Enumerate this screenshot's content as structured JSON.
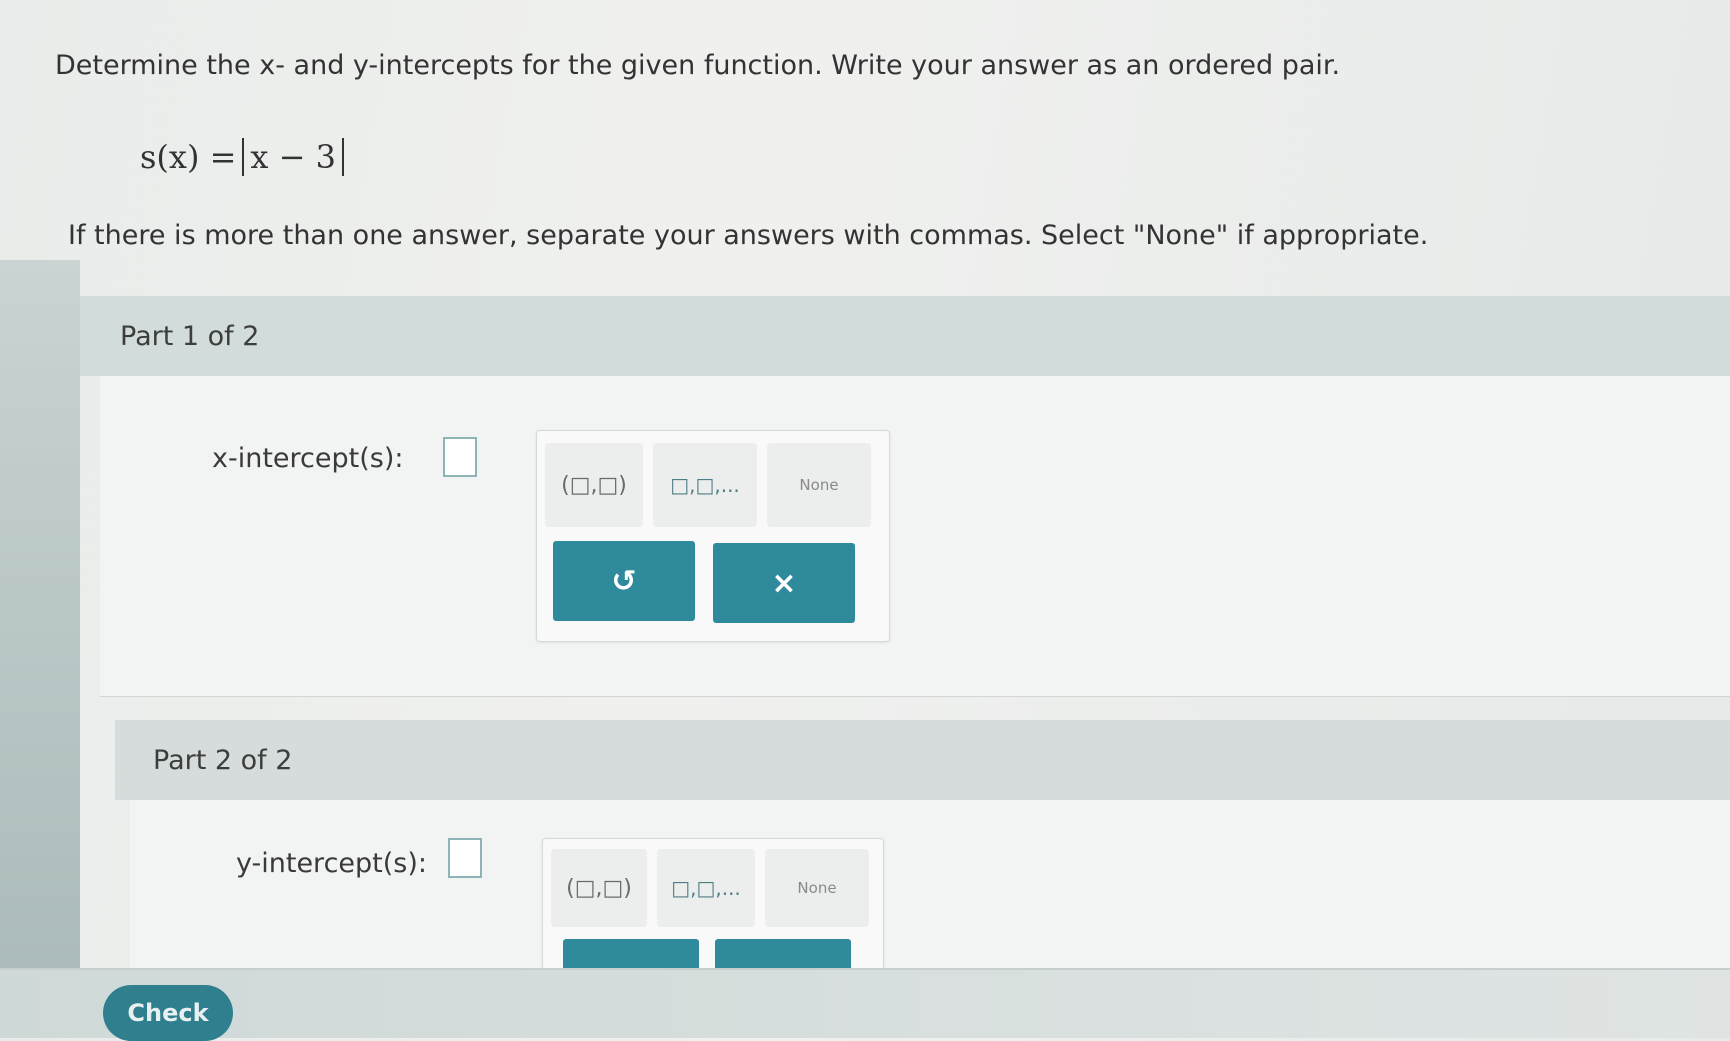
{
  "problem": {
    "prompt": "Determine the x- and y-intercepts for the given function. Write your answer as an ordered pair.",
    "function_lhs": "s(x) =",
    "function_abs": "x − 3",
    "instruction": "If there is more than one answer, separate your answers with commas. Select \"None\" if appropriate."
  },
  "part1": {
    "header": "Part 1 of 2",
    "label": "x-intercept(s):",
    "keypad": {
      "ordered_pair": "(□,□)",
      "list": "□,□,...",
      "none": "None",
      "undo": "↺",
      "clear": "×"
    }
  },
  "part2": {
    "header": "Part 2 of 2",
    "label": "y-intercept(s):",
    "keypad": {
      "ordered_pair": "(□,□)",
      "list": "□,□,...",
      "none": "None"
    }
  },
  "footer": {
    "check_label": "Check"
  },
  "colors": {
    "accent": "#2f8a9b",
    "header_bg": "#d2dcdb"
  }
}
